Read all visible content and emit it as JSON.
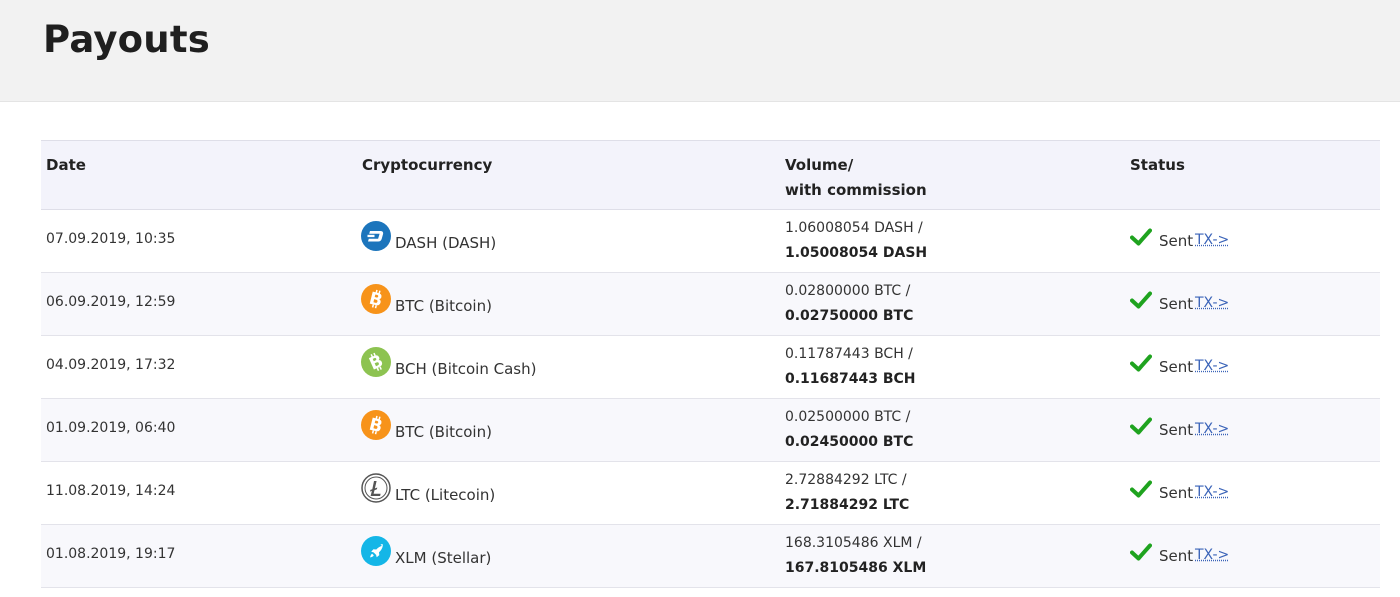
{
  "header": {
    "title": "Payouts"
  },
  "table": {
    "columns": {
      "date": "Date",
      "crypto": "Cryptocurrency",
      "volume_line1": "Volume/",
      "volume_line2": "with commission",
      "status": "Status"
    },
    "rows": [
      {
        "date": "07.09.2019, 10:35",
        "coin_icon": "dash-icon",
        "coin_color": "#1c75bc",
        "crypto": "DASH (DASH)",
        "volume": "1.06008054 DASH /",
        "net": "1.05008054 DASH",
        "status": "Sent",
        "link": "TX->"
      },
      {
        "date": "06.09.2019, 12:59",
        "coin_icon": "bitcoin-icon",
        "coin_color": "#f7931a",
        "crypto": "BTC (Bitcoin)",
        "volume": "0.02800000 BTC /",
        "net": "0.02750000 BTC",
        "status": "Sent",
        "link": "TX->"
      },
      {
        "date": "04.09.2019, 17:32",
        "coin_icon": "bitcoin-cash-icon",
        "coin_color": "#8dc351",
        "crypto": "BCH (Bitcoin Cash)",
        "volume": "0.11787443 BCH /",
        "net": "0.11687443 BCH",
        "status": "Sent",
        "link": "TX->"
      },
      {
        "date": "01.09.2019, 06:40",
        "coin_icon": "bitcoin-icon",
        "coin_color": "#f7931a",
        "crypto": "BTC (Bitcoin)",
        "volume": "0.02500000 BTC /",
        "net": "0.02450000 BTC",
        "status": "Sent",
        "link": "TX->"
      },
      {
        "date": "11.08.2019, 14:24",
        "coin_icon": "litecoin-icon",
        "coin_color": "#666666",
        "crypto": "LTC (Litecoin)",
        "volume": "2.72884292 LTC /",
        "net": "2.71884292 LTC",
        "status": "Sent",
        "link": "TX->"
      },
      {
        "date": "01.08.2019, 19:17",
        "coin_icon": "stellar-icon",
        "coin_color": "#14b6e7",
        "crypto": "XLM (Stellar)",
        "volume": "168.3105486 XLM /",
        "net": "167.8105486 XLM",
        "status": "Sent",
        "link": "TX->"
      }
    ]
  },
  "colors": {
    "check": "#1fa31f",
    "link": "#3a63b8",
    "header_bg": "#f2f2f2"
  }
}
